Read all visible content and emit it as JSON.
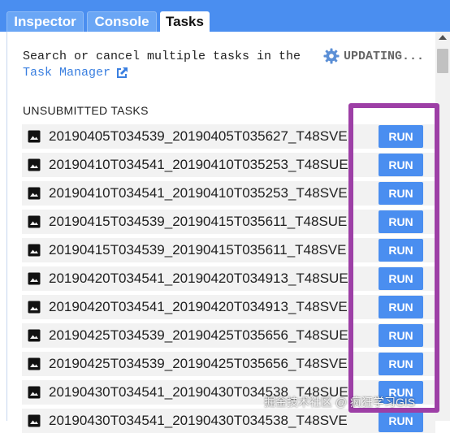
{
  "tabs": [
    {
      "label": "Inspector",
      "active": false
    },
    {
      "label": "Console",
      "active": false
    },
    {
      "label": "Tasks",
      "active": true
    }
  ],
  "intro": {
    "text": "Search or cancel multiple tasks in the",
    "link_text": "Task Manager",
    "link_icon": "open-in-new-icon"
  },
  "status": {
    "icon": "gear-icon",
    "text": "UPDATING..."
  },
  "section_title": "UNSUBMITTED TASKS",
  "tasks": [
    {
      "name": "20190405T034539_20190405T035627_T48SVE",
      "button": "RUN"
    },
    {
      "name": "20190410T034541_20190410T035253_T48SUE",
      "button": "RUN"
    },
    {
      "name": "20190410T034541_20190410T035253_T48SVE",
      "button": "RUN"
    },
    {
      "name": "20190415T034539_20190415T035611_T48SUE",
      "button": "RUN"
    },
    {
      "name": "20190415T034539_20190415T035611_T48SVE",
      "button": "RUN"
    },
    {
      "name": "20190420T034541_20190420T034913_T48SUE",
      "button": "RUN"
    },
    {
      "name": "20190420T034541_20190420T034913_T48SVE",
      "button": "RUN"
    },
    {
      "name": "20190425T034539_20190425T035656_T48SUE",
      "button": "RUN"
    },
    {
      "name": "20190425T034539_20190425T035656_T48SVE",
      "button": "RUN"
    },
    {
      "name": "20190430T034541_20190430T034538_T48SUE",
      "button": "RUN"
    },
    {
      "name": "20190430T034541_20190430T034538_T48SVE",
      "button": "RUN"
    }
  ],
  "row_icon": "image-icon",
  "watermark": "掘金技术社区 @ 疯狂学习GIS",
  "colors": {
    "tab_bar": "#4a8ef0",
    "run_button": "#4a8ef0",
    "link": "#3a7fe0",
    "highlight_frame": "#9d3fa6",
    "row_background": "#f2f2f2"
  }
}
